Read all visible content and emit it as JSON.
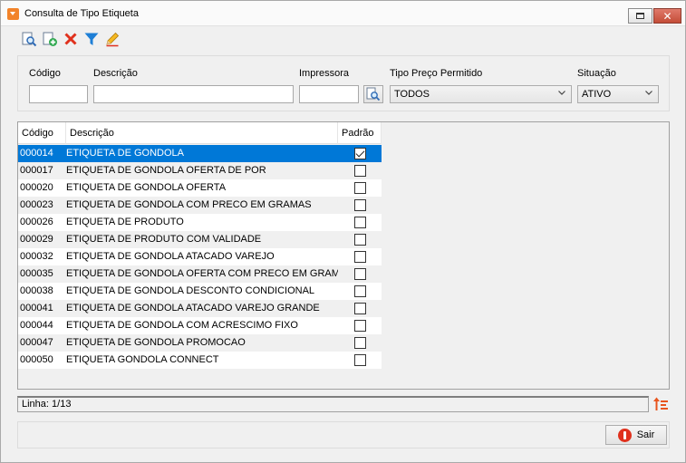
{
  "window": {
    "title": "Consulta de Tipo Etiqueta",
    "close_glyph": "✕"
  },
  "toolbar": {
    "icons": [
      "search-document-icon",
      "add-document-icon",
      "delete-x-icon",
      "filter-funnel-icon",
      "edit-pencil-icon"
    ]
  },
  "filters": {
    "codigo_label": "Código",
    "codigo_value": "",
    "descricao_label": "Descrição",
    "descricao_value": "",
    "impressora_label": "Impressora",
    "impressora_value": "",
    "tipo_preco_label": "Tipo Preço Permitido",
    "tipo_preco_value": "TODOS",
    "situacao_label": "Situação",
    "situacao_value": "ATIVO"
  },
  "grid": {
    "columns": {
      "codigo": "Código",
      "descricao": "Descrição",
      "padrao": "Padrão"
    },
    "rows": [
      {
        "codigo": "000014",
        "descricao": "ETIQUETA DE GONDOLA",
        "padrao": true
      },
      {
        "codigo": "000017",
        "descricao": "ETIQUETA DE GONDOLA OFERTA DE POR",
        "padrao": false
      },
      {
        "codigo": "000020",
        "descricao": "ETIQUETA DE GONDOLA OFERTA",
        "padrao": false
      },
      {
        "codigo": "000023",
        "descricao": "ETIQUETA DE GONDOLA COM PRECO EM GRAMAS",
        "padrao": false
      },
      {
        "codigo": "000026",
        "descricao": "ETIQUETA DE PRODUTO",
        "padrao": false
      },
      {
        "codigo": "000029",
        "descricao": "ETIQUETA DE PRODUTO COM VALIDADE",
        "padrao": false
      },
      {
        "codigo": "000032",
        "descricao": "ETIQUETA DE GONDOLA ATACADO VAREJO",
        "padrao": false
      },
      {
        "codigo": "000035",
        "descricao": "ETIQUETA DE GONDOLA OFERTA COM PRECO EM GRAMAS",
        "padrao": false
      },
      {
        "codigo": "000038",
        "descricao": "ETIQUETA DE GONDOLA DESCONTO CONDICIONAL",
        "padrao": false
      },
      {
        "codigo": "000041",
        "descricao": "ETIQUETA DE GONDOLA ATACADO VAREJO GRANDE",
        "padrao": false
      },
      {
        "codigo": "000044",
        "descricao": "ETIQUETA DE GONDOLA COM ACRESCIMO FIXO",
        "padrao": false
      },
      {
        "codigo": "000047",
        "descricao": "ETIQUETA DE GONDOLA PROMOCAO",
        "padrao": false
      },
      {
        "codigo": "000050",
        "descricao": "ETIQUETA GONDOLA CONNECT",
        "padrao": false
      }
    ],
    "selected_index": 0
  },
  "status": {
    "linha": "Linha: 1/13"
  },
  "footer": {
    "sair_label": "Sair"
  },
  "colors": {
    "selection": "#0078d7",
    "accent_orange": "#f2832a",
    "exit_red": "#e0311d"
  }
}
